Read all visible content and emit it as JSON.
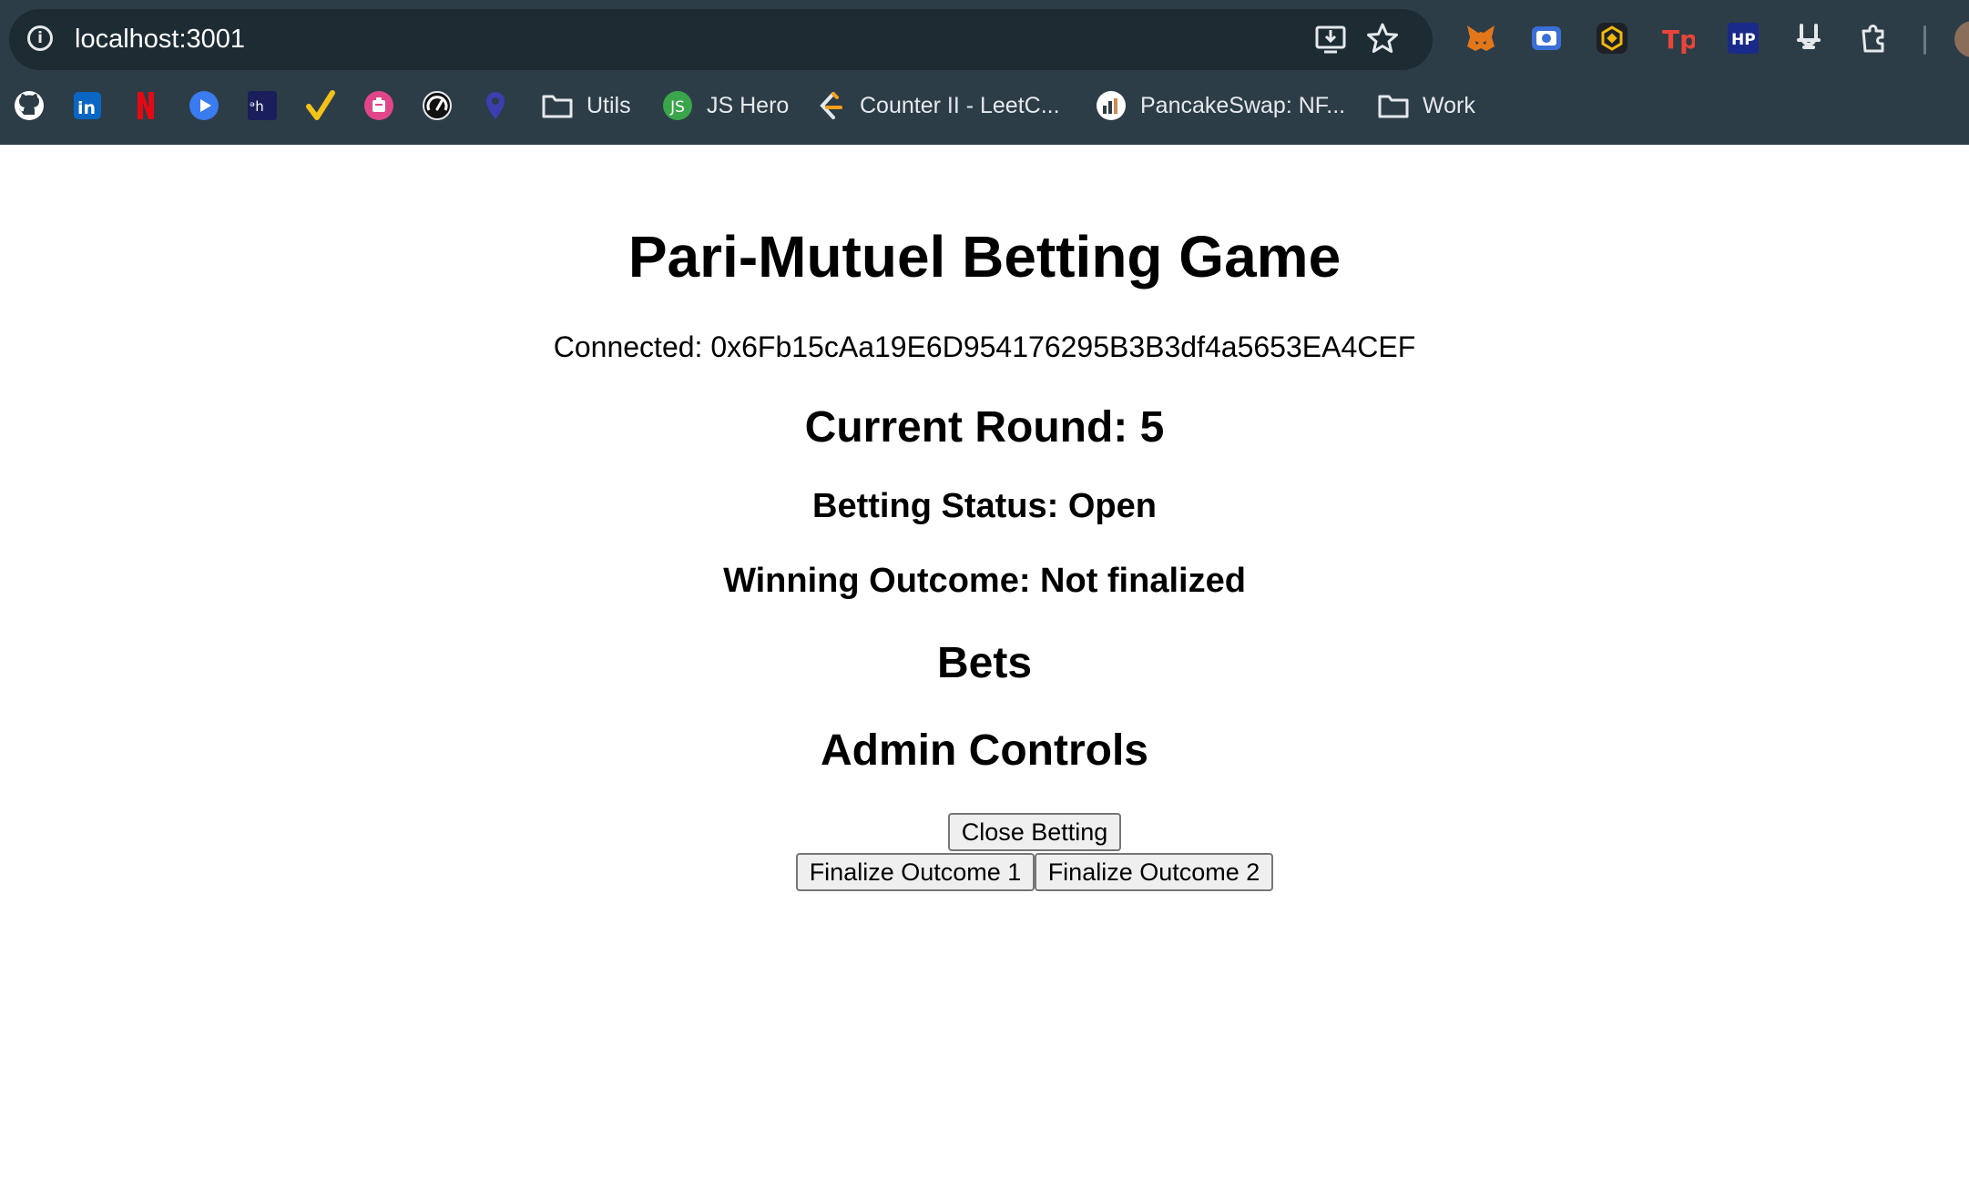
{
  "browser": {
    "url": "localhost:3001",
    "toolbar_icons": [
      "info-icon",
      "install-app-icon",
      "bookmark-star-icon"
    ],
    "extensions": [
      "metamask-icon",
      "screen-recorder-icon",
      "binance-wallet-icon",
      "tp-icon",
      "hp-icon",
      "bunny-icon",
      "extensions-puzzle-icon"
    ],
    "bookmarks": [
      {
        "icon": "github-icon",
        "label": ""
      },
      {
        "icon": "linkedin-icon",
        "label": ""
      },
      {
        "icon": "netflix-icon",
        "label": ""
      },
      {
        "icon": "play-icon",
        "label": ""
      },
      {
        "icon": "dh-icon",
        "label": ""
      },
      {
        "icon": "check-icon",
        "label": ""
      },
      {
        "icon": "clipboard-icon",
        "label": ""
      },
      {
        "icon": "speedometer-icon",
        "label": ""
      },
      {
        "icon": "location-pin-icon",
        "label": ""
      },
      {
        "icon": "folder-icon",
        "label": "Utils"
      },
      {
        "icon": "js-icon",
        "label": "JS Hero",
        "icon_text": "JS"
      },
      {
        "icon": "leetcode-icon",
        "label": "Counter II - LeetC..."
      },
      {
        "icon": "pancakeswap-icon",
        "label": "PancakeSwap: NF..."
      },
      {
        "icon": "folder-icon",
        "label": "Work"
      }
    ]
  },
  "page": {
    "title": "Pari-Mutuel Betting Game",
    "connected": "Connected: 0x6Fb15cAa19E6D954176295B3B3df4a5653EA4CEF",
    "current_round": "Current Round: 5",
    "betting_status": "Betting Status: Open",
    "winning_outcome": "Winning Outcome: Not finalized",
    "bets_heading": "Bets",
    "admin_heading": "Admin Controls",
    "buttons": {
      "close_betting": "Close Betting",
      "finalize_1": "Finalize Outcome 1",
      "finalize_2": "Finalize Outcome 2"
    }
  },
  "colors": {
    "chrome_bg": "#2d3d47",
    "omnibox_bg": "#1d2b33",
    "page_bg": "#ffffff",
    "button_bg": "#efefef",
    "button_border": "#767676"
  }
}
